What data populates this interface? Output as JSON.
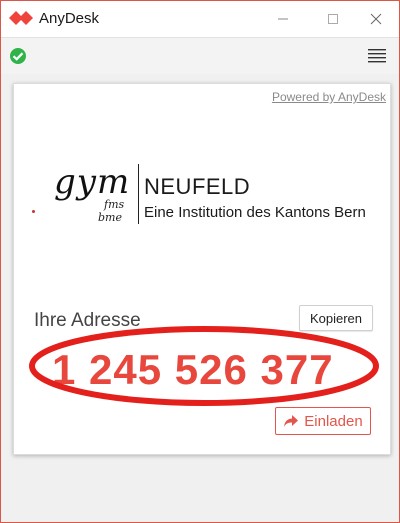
{
  "window": {
    "title": "AnyDesk",
    "controls": [
      "minimize",
      "maximize",
      "close"
    ]
  },
  "toolbar": {
    "status_icon": "check-circle-icon",
    "menu_icon": "hamburger-menu-icon"
  },
  "card": {
    "powered_by": "Powered by AnyDesk",
    "school_logo": {
      "wordmark": "gym",
      "line1": "fms",
      "line2": "bme",
      "name": "NEUFELD",
      "subtitle": "Eine Institution des Kantons Bern"
    },
    "address_label": "Ihre Adresse",
    "copy_label": "Kopieren",
    "address": "1 245 526 377",
    "invite_label": "Einladen"
  },
  "colors": {
    "accent": "#e4564b",
    "address": "#e8473d",
    "status_ok": "#2fb34a",
    "annotation": "#e3201b"
  }
}
